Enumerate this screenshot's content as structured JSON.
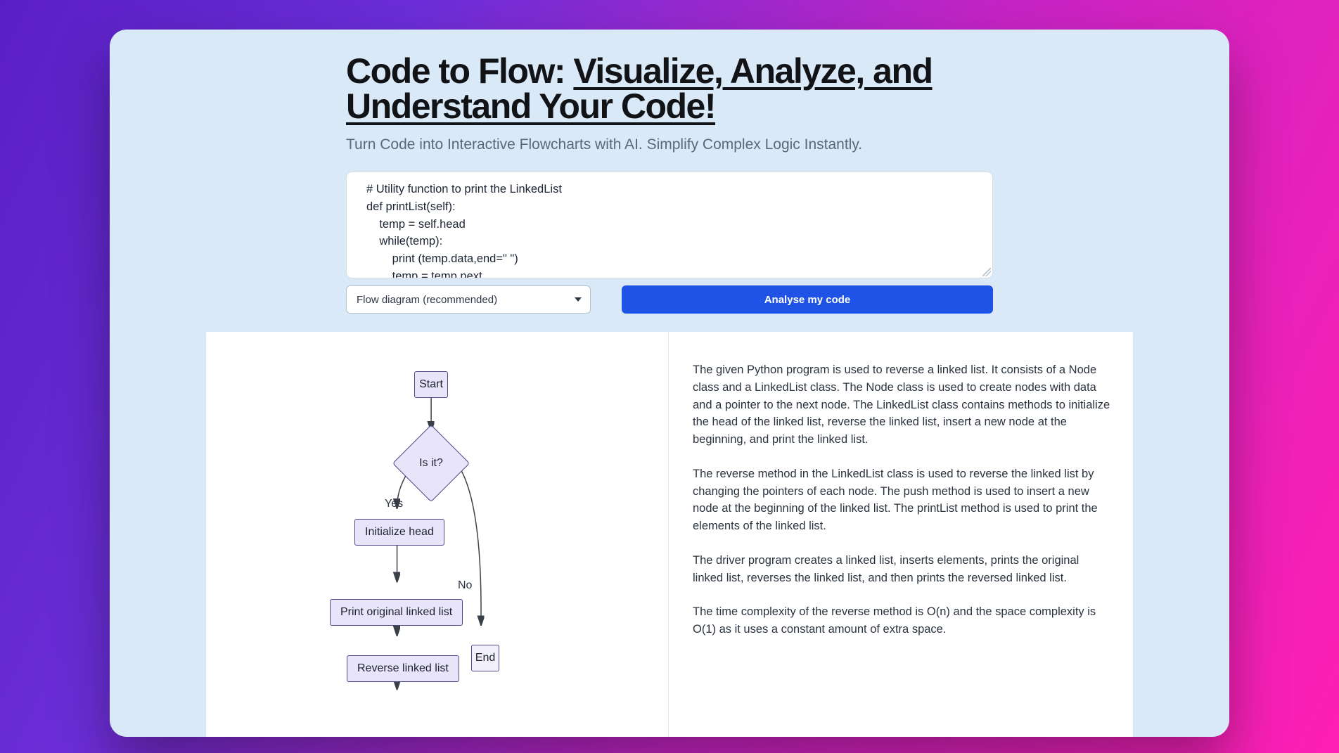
{
  "header": {
    "title_plain": "Code to Flow: ",
    "title_underlined": "Visualize, Analyze, and Understand Your Code!",
    "subtitle": "Turn Code into Interactive Flowcharts with AI. Simplify Complex Logic Instantly."
  },
  "code_input": "# Utility function to print the LinkedList\ndef printList(self):\n    temp = self.head\n    while(temp):\n        print (temp.data,end=\" \")\n        temp = temp.next",
  "select": {
    "selected": "Flow diagram (recommended)"
  },
  "analyse_button": "Analyse my code",
  "chart_data": {
    "type": "flowchart",
    "nodes": [
      {
        "id": "start",
        "kind": "terminator",
        "label": "Start"
      },
      {
        "id": "cond",
        "kind": "decision",
        "label": "Is it?"
      },
      {
        "id": "init",
        "kind": "process",
        "label": "Initialize head"
      },
      {
        "id": "print",
        "kind": "process",
        "label": "Print original linked list"
      },
      {
        "id": "rev",
        "kind": "process",
        "label": "Reverse linked list"
      },
      {
        "id": "end",
        "kind": "terminator",
        "label": "End"
      }
    ],
    "edges": [
      {
        "from": "start",
        "to": "cond",
        "label": ""
      },
      {
        "from": "cond",
        "to": "init",
        "label": "Yes"
      },
      {
        "from": "cond",
        "to": "end",
        "label": "No"
      },
      {
        "from": "init",
        "to": "print",
        "label": ""
      },
      {
        "from": "print",
        "to": "rev",
        "label": ""
      }
    ]
  },
  "explanation": {
    "p1": "The given Python program is used to reverse a linked list. It consists of a Node class and a LinkedList class. The Node class is used to create nodes with data and a pointer to the next node. The LinkedList class contains methods to initialize the head of the linked list, reverse the linked list, insert a new node at the beginning, and print the linked list.",
    "p2": "The reverse method in the LinkedList class is used to reverse the linked list by changing the pointers of each node. The push method is used to insert a new node at the beginning of the linked list. The printList method is used to print the elements of the linked list.",
    "p3": "The driver program creates a linked list, inserts elements, prints the original linked list, reverses the linked list, and then prints the reversed linked list.",
    "p4": "The time complexity of the reverse method is O(n) and the space complexity is O(1) as it uses a constant amount of extra space."
  }
}
